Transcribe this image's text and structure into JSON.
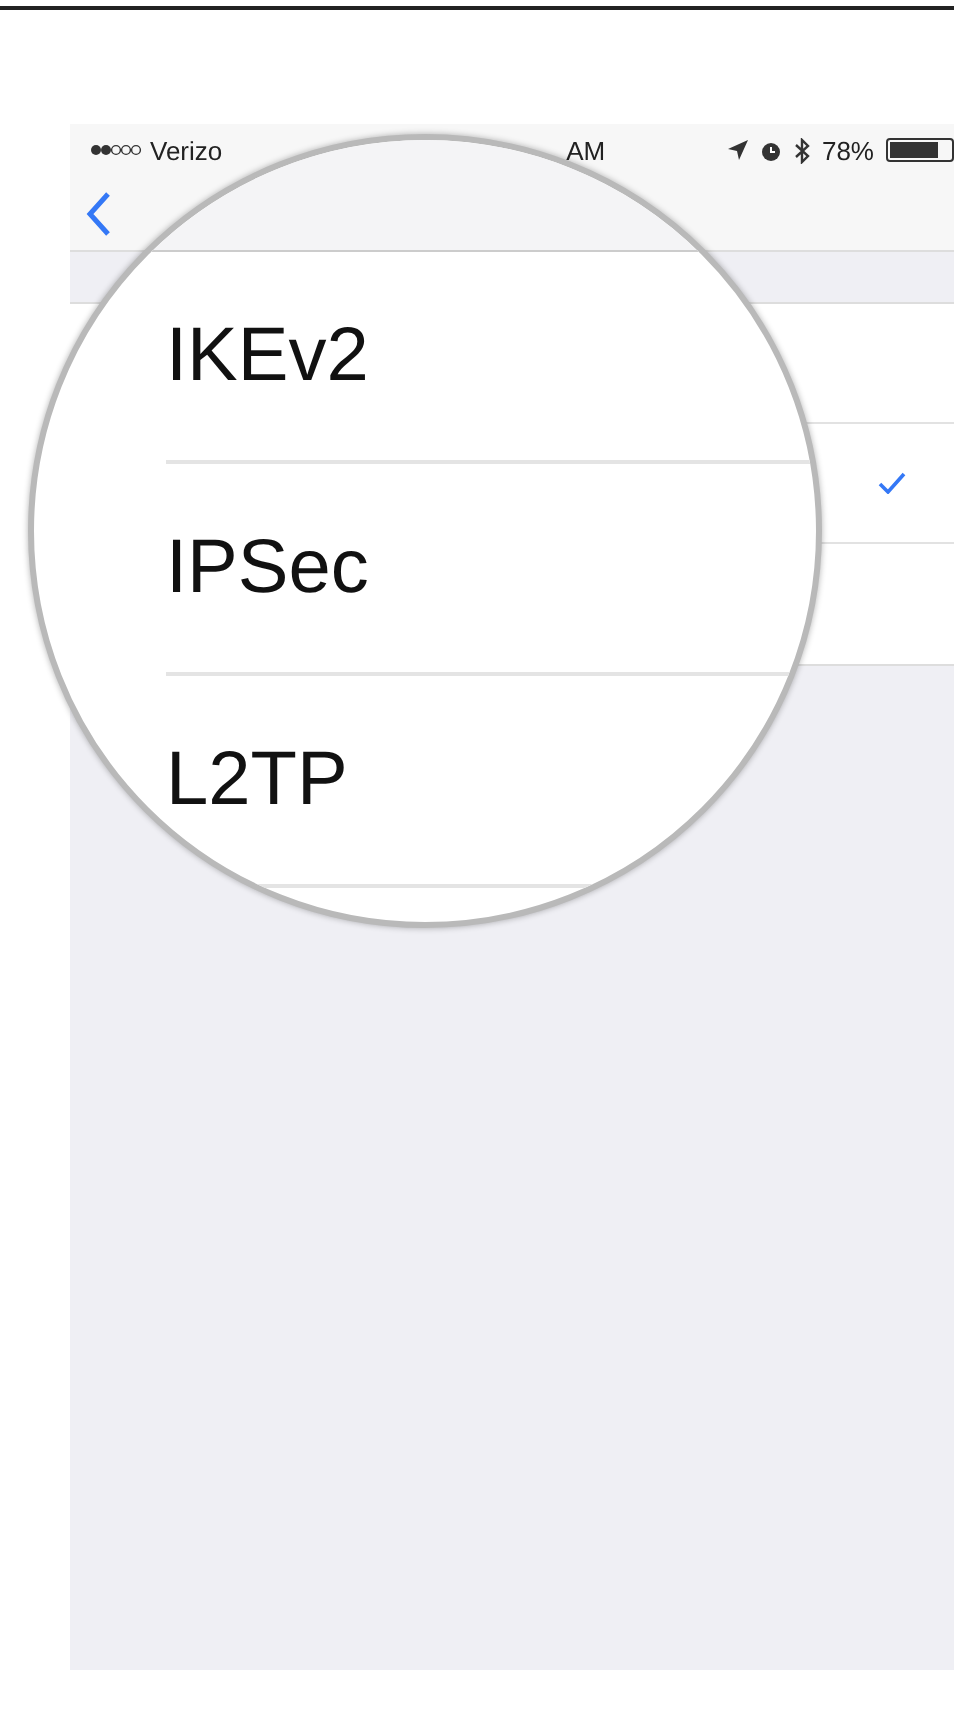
{
  "status_bar": {
    "carrier": "Verizo",
    "time": "AM",
    "battery": "78%"
  },
  "vpn_types": [
    {
      "label": "IKEv2",
      "selected": false
    },
    {
      "label": "IPSec",
      "selected": true
    },
    {
      "label": "L2TP",
      "selected": false
    }
  ]
}
